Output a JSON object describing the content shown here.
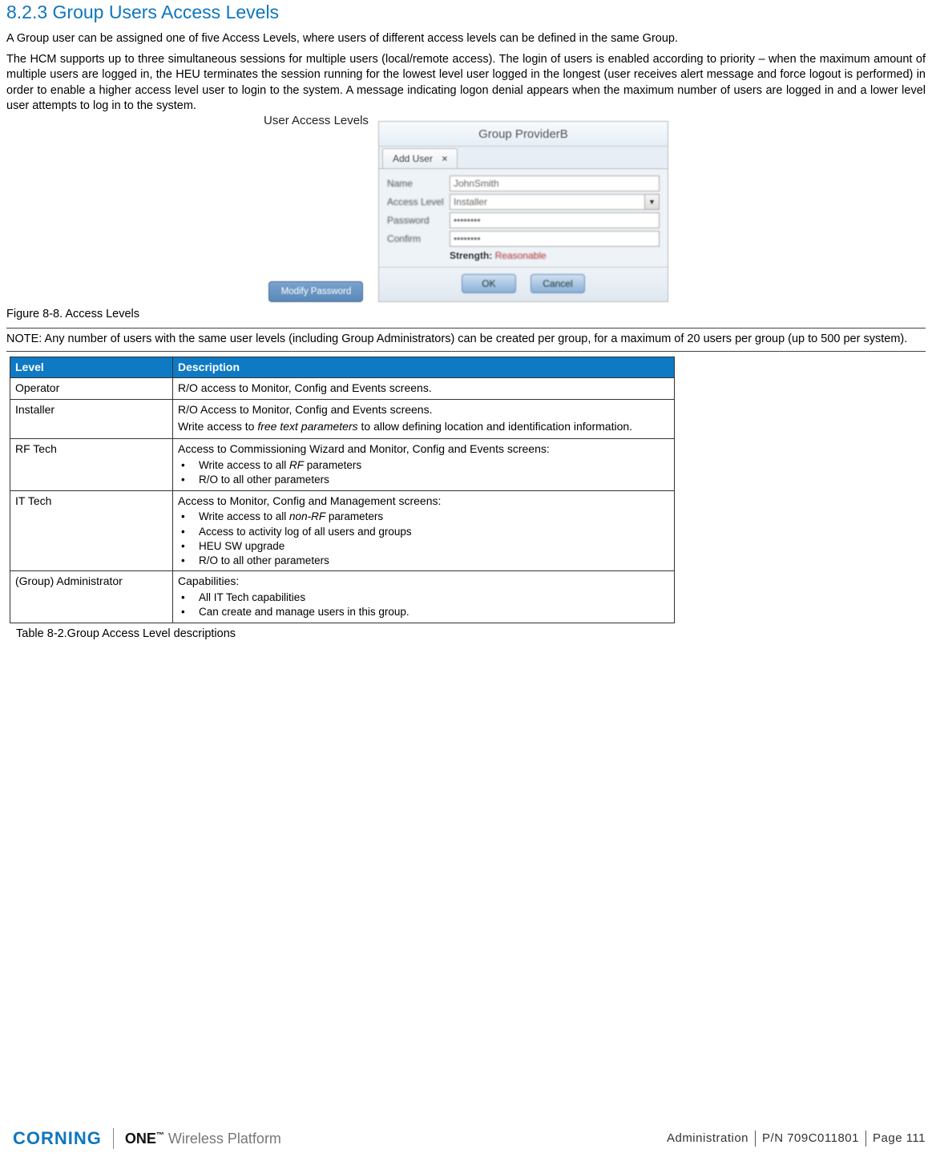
{
  "heading": "8.2.3 Group Users Access Levels",
  "para1": "A Group user can be assigned one of five Access Levels, where users of different access levels can be defined in the same Group.",
  "para2": "The HCM supports up to three simultaneous sessions for multiple users (local/remote access). The login of users is enabled according to priority – when the maximum amount of multiple users are logged in, the HEU terminates the session running for the lowest level user logged in the longest (user receives alert message and force logout is performed) in order to enable a higher access level user to login to the system.   A message indicating logon denial appears when the maximum number of users are logged in and a lower level user attempts to log in to the system.",
  "figure": {
    "pointer_label": "User Access Levels",
    "group_title": "Group ProviderB",
    "tab_label": "Add User",
    "modify_btn": "Modify Password",
    "fields": {
      "name_label": "Name",
      "name_value": "JohnSmith",
      "access_label": "Access Level",
      "access_value": "Installer",
      "password_label": "Password",
      "password_value": "••••••••",
      "confirm_label": "Confirm",
      "confirm_value": "••••••••",
      "strength_label": "Strength:",
      "strength_value": "Reasonable"
    },
    "ok_btn": "OK",
    "cancel_btn": "Cancel"
  },
  "fig_caption": "Figure 8-8. Access Levels",
  "note": "NOTE: Any number of users with the same user levels (including Group Administrators) can be created per group, for a maximum of 20 users per group (up to 500 per system).",
  "table": {
    "headers": {
      "level": "Level",
      "desc": "Description"
    },
    "rows": [
      {
        "level": "Operator",
        "intro": "R/O access to Monitor, Config and Events screens.",
        "bullets": []
      },
      {
        "level": "Installer",
        "intro": "R/O Access to Monitor, Config and Events screens.",
        "extra_pre": "Write access to ",
        "extra_italic": "free text parameters",
        "extra_post": " to allow defining location and identification information.",
        "bullets": []
      },
      {
        "level": "RF Tech",
        "intro": "Access to Commissioning Wizard and Monitor, Config and Events screens:",
        "bullets": [
          {
            "pre": "Write access to all ",
            "italic": "RF",
            "post": " parameters"
          },
          {
            "pre": "R/O to all other parameters",
            "italic": "",
            "post": ""
          }
        ]
      },
      {
        "level": "IT Tech",
        "intro": "Access to Monitor, Config and Management screens:",
        "bullets": [
          {
            "pre": "Write access to all ",
            "italic": "non-RF",
            "post": " parameters"
          },
          {
            "pre": "Access to activity log of all users and groups",
            "italic": "",
            "post": ""
          },
          {
            "pre": "HEU SW upgrade",
            "italic": "",
            "post": ""
          },
          {
            "pre": "R/O to all other parameters",
            "italic": "",
            "post": ""
          }
        ]
      },
      {
        "level": "(Group) Administrator",
        "intro": "Capabilities:",
        "bullets": [
          {
            "pre": "All IT Tech capabilities",
            "italic": "",
            "post": ""
          },
          {
            "pre": "Can create and manage users in this group.",
            "italic": "",
            "post": ""
          }
        ]
      }
    ]
  },
  "table_caption": "Table 8-2.Group Access Level descriptions",
  "footer": {
    "brand1": "CORNING",
    "brand2_bold": "ONE",
    "brand2_tm": "™",
    "brand2_rest": " Wireless Platform",
    "section": "Administration",
    "pn": "P/N 709C011801",
    "page": "Page 111"
  }
}
